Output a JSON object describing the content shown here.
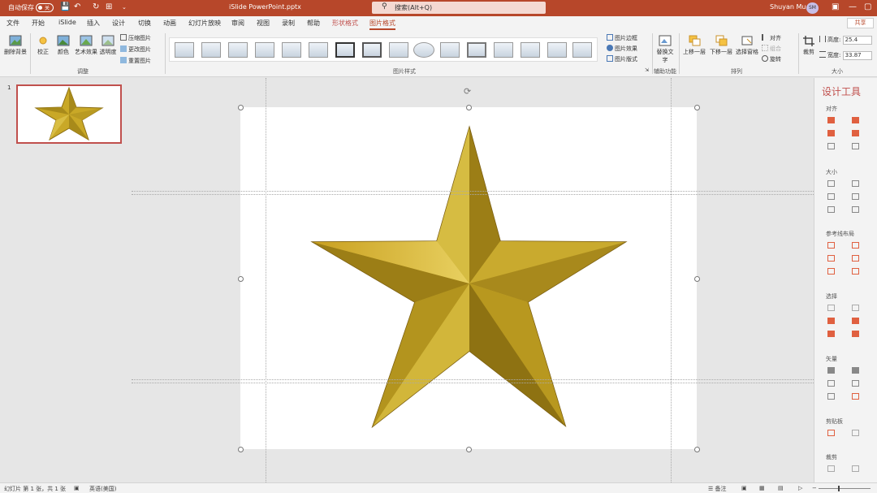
{
  "titlebar": {
    "autosave_label": "自动保存",
    "autosave_state": "关",
    "document_title": "iSlide PowerPoint.pptx",
    "search_placeholder": "搜索(Alt+Q)",
    "user_name": "Shuyan Mu",
    "user_initials": "SM"
  },
  "tabs": [
    {
      "label": "文件"
    },
    {
      "label": "开始"
    },
    {
      "label": "iSlide"
    },
    {
      "label": "插入"
    },
    {
      "label": "设计"
    },
    {
      "label": "切换"
    },
    {
      "label": "动画"
    },
    {
      "label": "幻灯片放映"
    },
    {
      "label": "审阅"
    },
    {
      "label": "视图"
    },
    {
      "label": "录制"
    },
    {
      "label": "帮助"
    },
    {
      "label": "形状格式"
    },
    {
      "label": "图片格式"
    }
  ],
  "share_label": "共享",
  "ribbon": {
    "remove_bg": "删除背景",
    "corrections": "校正",
    "color": "颜色",
    "artistic": "艺术效果",
    "transparency": "透明度",
    "compress": "压缩图片",
    "change_picture": "更改图片",
    "reset_picture": "重置图片",
    "group_adjust": "调整",
    "group_styles": "图片样式",
    "border": "图片边框",
    "effects": "图片效果",
    "layout": "图片版式",
    "alt_text": "替换文字",
    "group_access": "辅助功能",
    "bring_forward": "上移一层",
    "send_backward": "下移一层",
    "selection_pane": "选择窗格",
    "align": "对齐",
    "group_obj": "组合",
    "rotate": "旋转",
    "group_arrange": "排列",
    "crop": "裁剪",
    "height_label": "高度:",
    "height_value": "25.4",
    "width_label": "宽度:",
    "width_value": "33.87",
    "group_size": "大小"
  },
  "slides": {
    "number": "1"
  },
  "design_panel": {
    "title": "设计工具",
    "sections": [
      "对齐",
      "大小",
      "参考线布局",
      "选择",
      "矢量",
      "剪贴板",
      "裁剪"
    ]
  },
  "status": {
    "slide_info": "幻灯片 第 1 张，共 1 张",
    "language": "英语(美国)",
    "notes": "备注"
  },
  "colors": {
    "accent": "#b7472a",
    "context_tab": "#c0504d"
  }
}
